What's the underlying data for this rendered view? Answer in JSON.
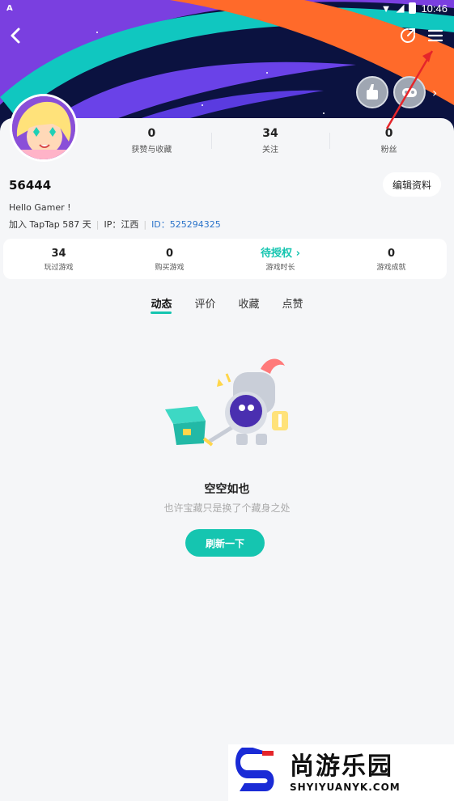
{
  "status": {
    "left_indicator": "A",
    "time": "10:46"
  },
  "profile": {
    "stats": [
      {
        "value": "0",
        "label": "获赞与收藏"
      },
      {
        "value": "34",
        "label": "关注"
      },
      {
        "value": "0",
        "label": "粉丝"
      }
    ],
    "username": "56444",
    "edit_label": "编辑资料",
    "bio": "Hello Gamer !",
    "joined": "加入 TapTap 587 天",
    "ip": "IP：江西",
    "uid": "ID：525294325"
  },
  "game_stats": [
    {
      "value": "34",
      "label": "玩过游戏"
    },
    {
      "value": "0",
      "label": "购买游戏"
    },
    {
      "value": "待授权",
      "label": "游戏时长"
    },
    {
      "value": "0",
      "label": "游戏成就"
    }
  ],
  "tabs": [
    "动态",
    "评价",
    "收藏",
    "点赞"
  ],
  "empty": {
    "title": "空空如也",
    "subtitle": "也许宝藏只是换了个藏身之处",
    "button": "刷新一下"
  },
  "watermark": {
    "brand": "尚游乐园",
    "domain": "SHYIYUANYK.COM"
  },
  "colors": {
    "accent": "#15c5b0",
    "uid": "#2a73c9"
  },
  "icons": {
    "back": "chevron-left-icon",
    "share": "share-icon",
    "menu": "menu-icon"
  }
}
